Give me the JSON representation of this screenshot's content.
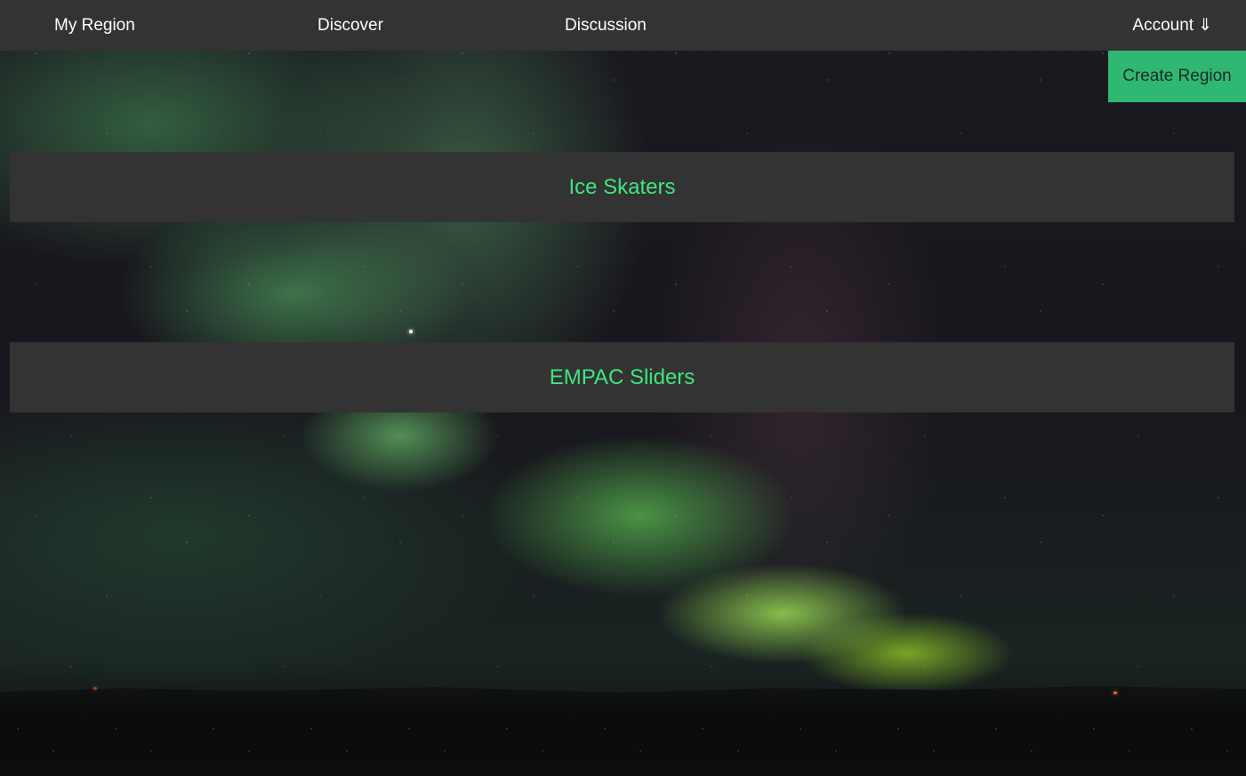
{
  "nav": {
    "my_region": "My Region",
    "discover": "Discover",
    "discussion": "Discussion",
    "account": "Account",
    "account_arrow": "⇓"
  },
  "actions": {
    "create_region": "Create Region"
  },
  "regions": [
    {
      "name": "Ice Skaters"
    },
    {
      "name": "EMPAC Sliders"
    }
  ],
  "background": {
    "icon": "aurora-night-sky-image"
  },
  "colors": {
    "navbar": "#333333",
    "card": "#333333",
    "accent_green": "#2eb872",
    "region_name": "#3ee67f",
    "nav_text": "#ffffff"
  }
}
